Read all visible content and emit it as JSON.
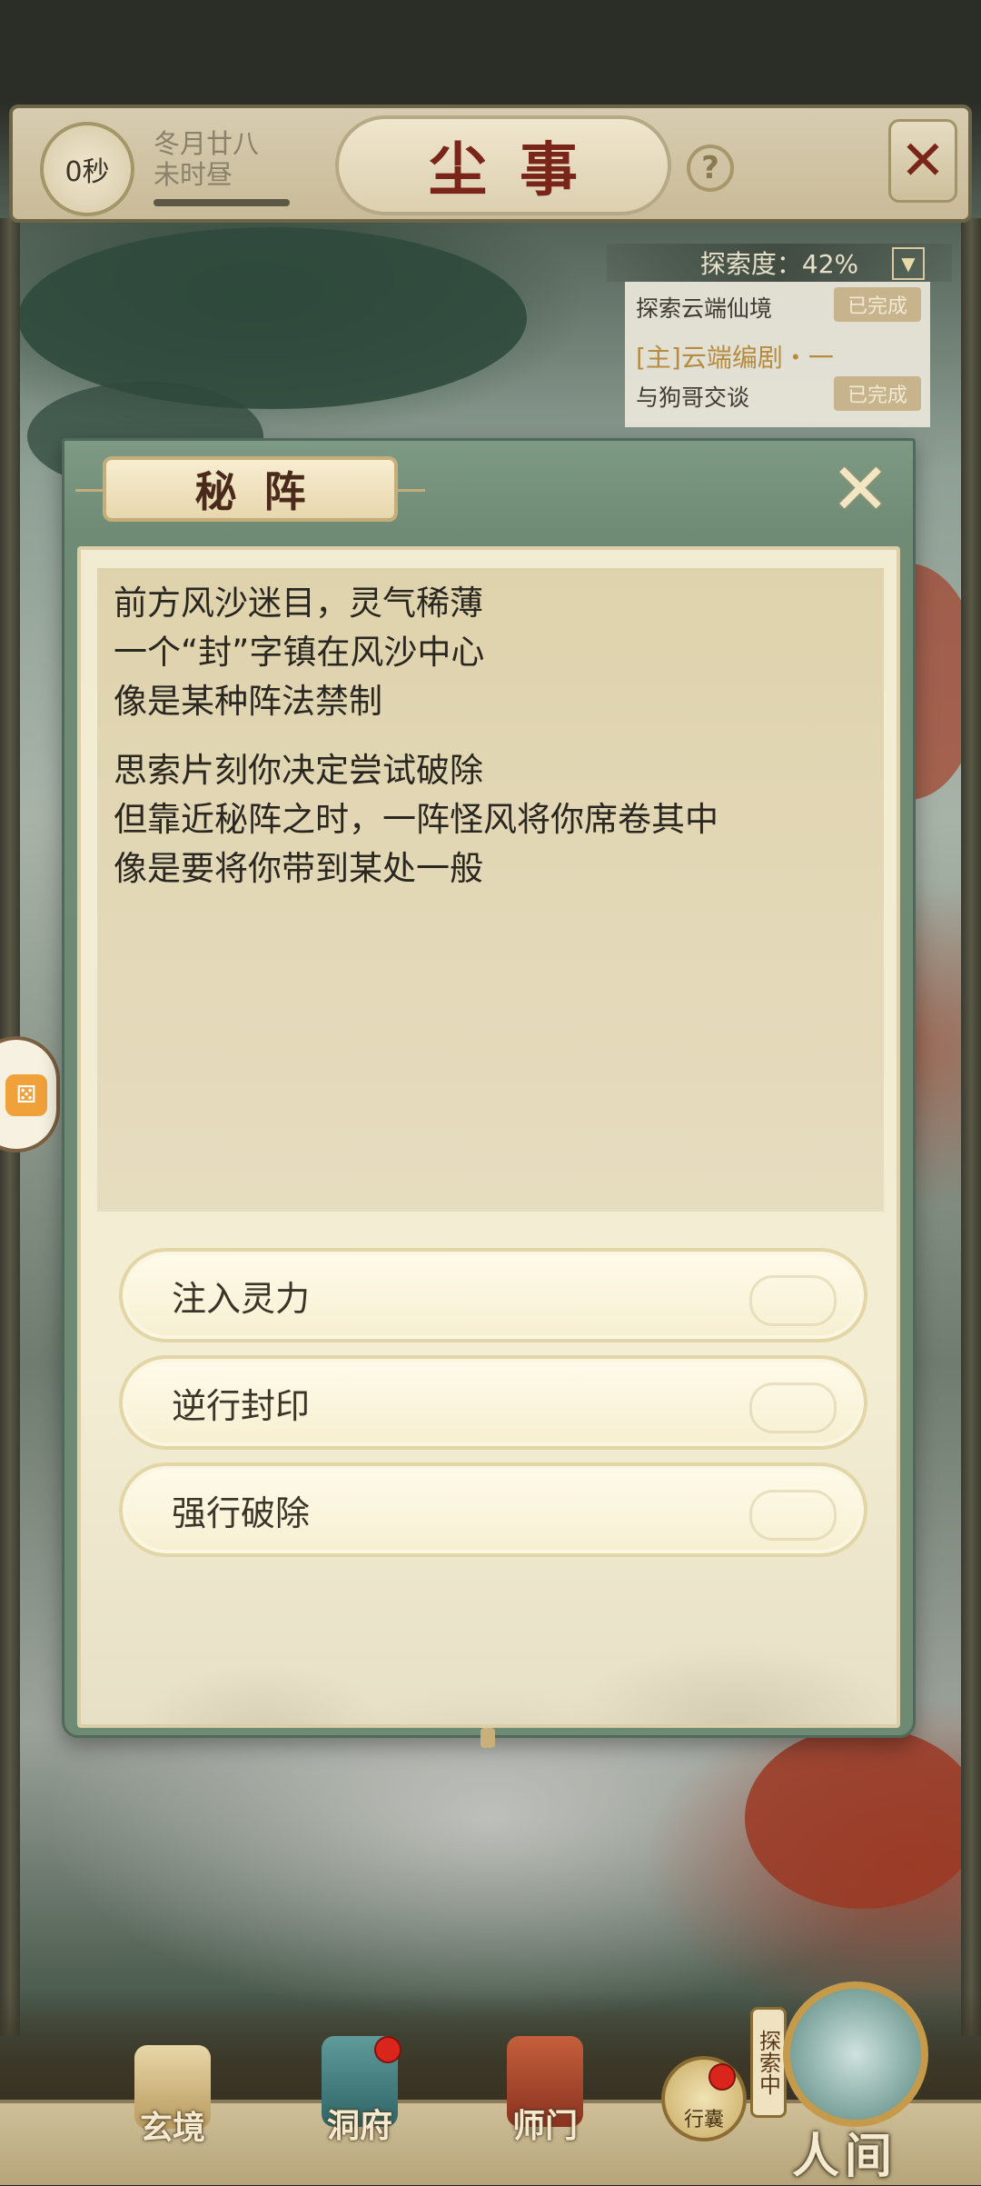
{
  "header": {
    "timer": "0秒",
    "date_line1": "冬月廿八",
    "date_line2": "未时昼",
    "title": "尘事",
    "help_icon": "?",
    "close_icon": "close-x-icon"
  },
  "explore": {
    "label": "探索度：42%",
    "progress_percent": 42,
    "toggle_icon": "chevron-down-icon",
    "quests": [
      {
        "text": "探索云端仙境",
        "status": "已完成",
        "type": "normal"
      },
      {
        "text": "[主]云端编剧・一",
        "status": "",
        "type": "main"
      },
      {
        "text": "与狗哥交谈",
        "status": "已完成",
        "type": "normal"
      }
    ]
  },
  "modal": {
    "title": "秘阵",
    "close_icon": "close-x-icon",
    "story_paragraphs": [
      [
        "前方风沙迷目，灵气稀薄",
        "一个“封”字镇在风沙中心",
        "像是某种阵法禁制"
      ],
      [
        "思索片刻你决定尝试破除",
        "但靠近秘阵之时，一阵怪风将你席卷其中",
        "像是要将你带到某处一般"
      ]
    ],
    "choices": [
      "注入灵力",
      "逆行封印",
      "强行破除"
    ]
  },
  "bottom_nav": {
    "items": [
      {
        "label": "玄境",
        "icon": "scroll-icon",
        "badge": false
      },
      {
        "label": "洞府",
        "icon": "lantern-icon",
        "badge": true
      },
      {
        "label": "师门",
        "icon": "banner-icon",
        "badge": false
      }
    ],
    "bag_label": "行囊",
    "bag_badge": true,
    "exploring_label": "探索中",
    "world_label": "人间"
  },
  "colors": {
    "title_red": "#7a2519",
    "modal_green": "#6f8b75",
    "paper": "#f1ebd1",
    "badge_red": "#d9251c"
  }
}
